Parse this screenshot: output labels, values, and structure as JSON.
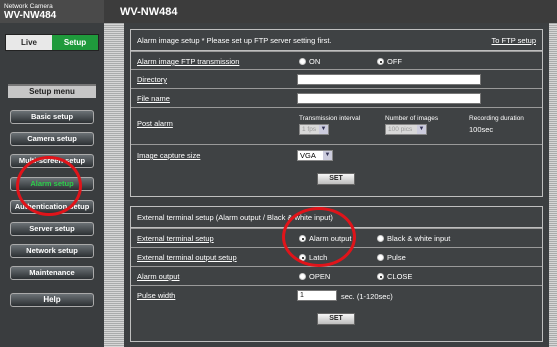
{
  "header": {
    "product_line": "Network Camera",
    "model_left": "WV-NW484",
    "model_title": "WV-NW484"
  },
  "sidebar": {
    "live_label": "Live",
    "setup_label": "Setup",
    "menu_title": "Setup menu",
    "items": [
      {
        "label": "Basic setup"
      },
      {
        "label": "Camera setup"
      },
      {
        "label": "Multi-screen setup"
      },
      {
        "label": "Alarm setup"
      },
      {
        "label": "Authentication setup"
      },
      {
        "label": "Server setup"
      },
      {
        "label": "Network setup"
      },
      {
        "label": "Maintenance"
      }
    ],
    "help_label": "Help"
  },
  "alarm_image": {
    "section_title": "Alarm image setup   * Please set up FTP server setting first.",
    "ftp_link": "To FTP setup",
    "ftp_transmission_label": "Alarm image FTP transmission",
    "on_label": "ON",
    "off_label": "OFF",
    "directory_label": "Directory",
    "file_name_label": "File name",
    "post_alarm_label": "Post alarm",
    "interval_header": "Transmission interval",
    "num_images_header": "Number of images",
    "duration_header": "Recording duration",
    "interval_value": "1 fps",
    "num_images_value": "100 pics",
    "duration_value": "100sec",
    "capture_size_label": "Image capture size",
    "capture_size_value": "VGA",
    "set_label": "SET"
  },
  "ext_terminal": {
    "section_title": "External terminal setup (Alarm output / Black & white input)",
    "setup_label": "External terminal setup",
    "alarm_output_opt": "Alarm output",
    "bw_input_opt": "Black & white input",
    "output_setup_label": "External terminal output setup",
    "latch_opt": "Latch",
    "pulse_opt": "Pulse",
    "alarm_output_label": "Alarm output",
    "open_opt": "OPEN",
    "close_opt": "CLOSE",
    "pulse_width_label": "Pulse width",
    "pulse_width_value": "1",
    "pulse_width_unit": "sec. (1-120sec)",
    "set_label": "SET"
  },
  "colors": {
    "active_green": "#2ccf4b",
    "setup_tab": "#1f9a3c",
    "annotation_red": "#e0141a"
  }
}
